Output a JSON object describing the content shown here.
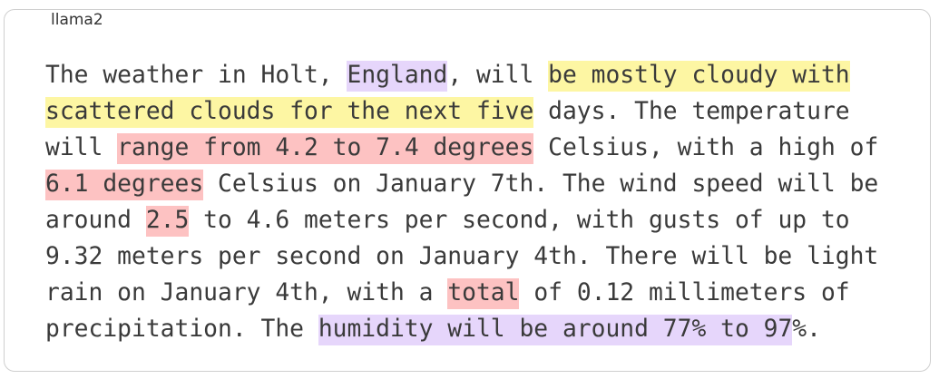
{
  "card": {
    "label": "llama2"
  },
  "colors": {
    "purple": "#e6d6fb",
    "yellow": "#fdf6a3",
    "red": "#fdc2c2",
    "text": "#3a3a3a",
    "border": "#cfcfcf"
  },
  "passage": {
    "segments": [
      {
        "text": "The weather in Holt, ",
        "highlight": null
      },
      {
        "text": "England",
        "highlight": "purple"
      },
      {
        "text": ", will ",
        "highlight": null
      },
      {
        "text": "be mostly cloudy with scattered clouds for the next five",
        "highlight": "yellow"
      },
      {
        "text": " days. The temperature will ",
        "highlight": null
      },
      {
        "text": "range from 4.2 to 7.4 degrees",
        "highlight": "red"
      },
      {
        "text": " Celsius, with a high of ",
        "highlight": null
      },
      {
        "text": "6.1 degrees",
        "highlight": "red"
      },
      {
        "text": " Celsius on January 7th. The wind speed will be around ",
        "highlight": null
      },
      {
        "text": "2.5",
        "highlight": "red"
      },
      {
        "text": " to 4.6 meters per second, with gusts of up to 9.32 meters per second on January 4th. There will be light rain on January 4th, with a ",
        "highlight": null
      },
      {
        "text": "total",
        "highlight": "red"
      },
      {
        "text": " of 0.12 millimeters of precipitation. The ",
        "highlight": null
      },
      {
        "text": "humidity will be around 77% to 97",
        "highlight": "purple"
      },
      {
        "text": "%.",
        "highlight": null
      }
    ]
  }
}
